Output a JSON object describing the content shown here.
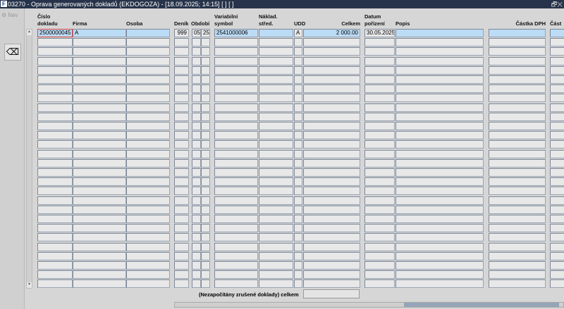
{
  "window": {
    "icon": "form-icon",
    "title": "03270 - Oprava generovaných dokladů (EKDOGOZA) - [18.09.2025; 14:15] [ ] [ ]",
    "controls": "🗗✕"
  },
  "sidebar": {
    "nav_label": "Nav",
    "tool_icon": "eraser-icon"
  },
  "columns": {
    "cislo": "Číslo\ndokladu",
    "firma": "Firma",
    "osoba": "Osoba",
    "denik": "Deník",
    "obdobi": "Období",
    "varsym": "Variabilní\nsymbol",
    "naklad": "Náklad.\nstřed.",
    "udd": "UDD",
    "celkem": "Celkem",
    "datum": "Datum\npořízení",
    "popis": "Popis",
    "dph": "Částka DPH",
    "cast": "Část"
  },
  "rows": [
    {
      "cislo": "2500000045",
      "firma": "A",
      "osoba": "",
      "denik": "999",
      "obd_m": "05",
      "obd_y": "25",
      "varsym": "2541000006",
      "naklad": "",
      "udd": "A",
      "celkem": "2 000.00",
      "datum": "30.05.2025",
      "popis": "",
      "dph": "",
      "cast": ""
    }
  ],
  "footer": {
    "sum_label": "(Nezapočítány zrušené doklady) celkem",
    "sum_value": ""
  }
}
